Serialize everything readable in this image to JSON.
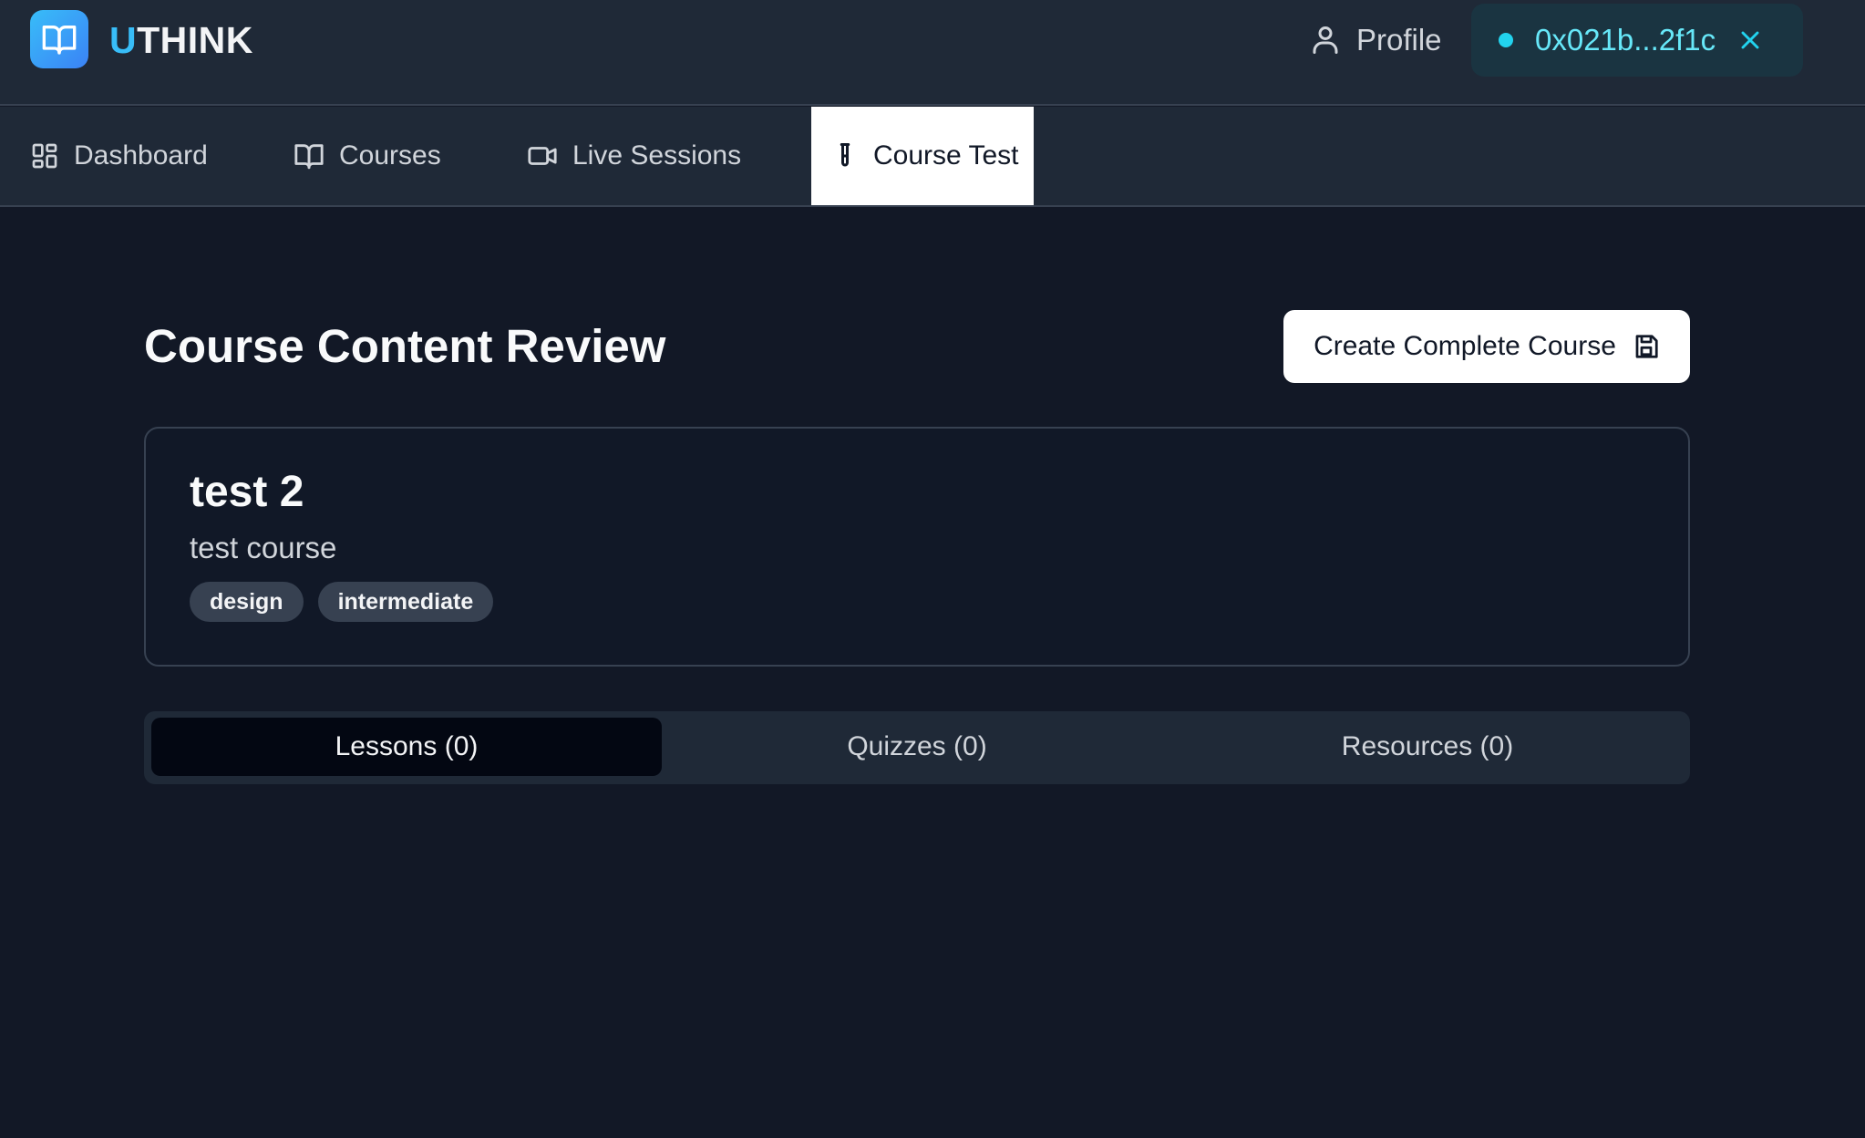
{
  "header": {
    "brand_prefix": "U",
    "brand_rest": "THINK",
    "logo_icon": "book-open-icon",
    "profile_label": "Profile",
    "wallet_address": "0x021b...2f1c"
  },
  "nav": {
    "items": [
      {
        "label": "Dashboard",
        "icon": "dashboard-icon"
      },
      {
        "label": "Courses",
        "icon": "book-open-icon"
      },
      {
        "label": "Live Sessions",
        "icon": "video-camera-icon"
      },
      {
        "label": "Course Test",
        "icon": "test-tube-icon",
        "active": true
      }
    ]
  },
  "main": {
    "title": "Course Content Review",
    "create_button_label": "Create Complete Course",
    "course": {
      "name": "test 2",
      "description": "test course",
      "tags": [
        "design",
        "intermediate"
      ]
    },
    "tabs": [
      {
        "label": "Lessons (0)",
        "active": true
      },
      {
        "label": "Quizzes (0)"
      },
      {
        "label": "Resources (0)"
      }
    ]
  },
  "colors": {
    "background": "#121826",
    "header_bg": "#1f2937",
    "accent": "#38bdf8",
    "wallet_text": "#67e8f9"
  }
}
